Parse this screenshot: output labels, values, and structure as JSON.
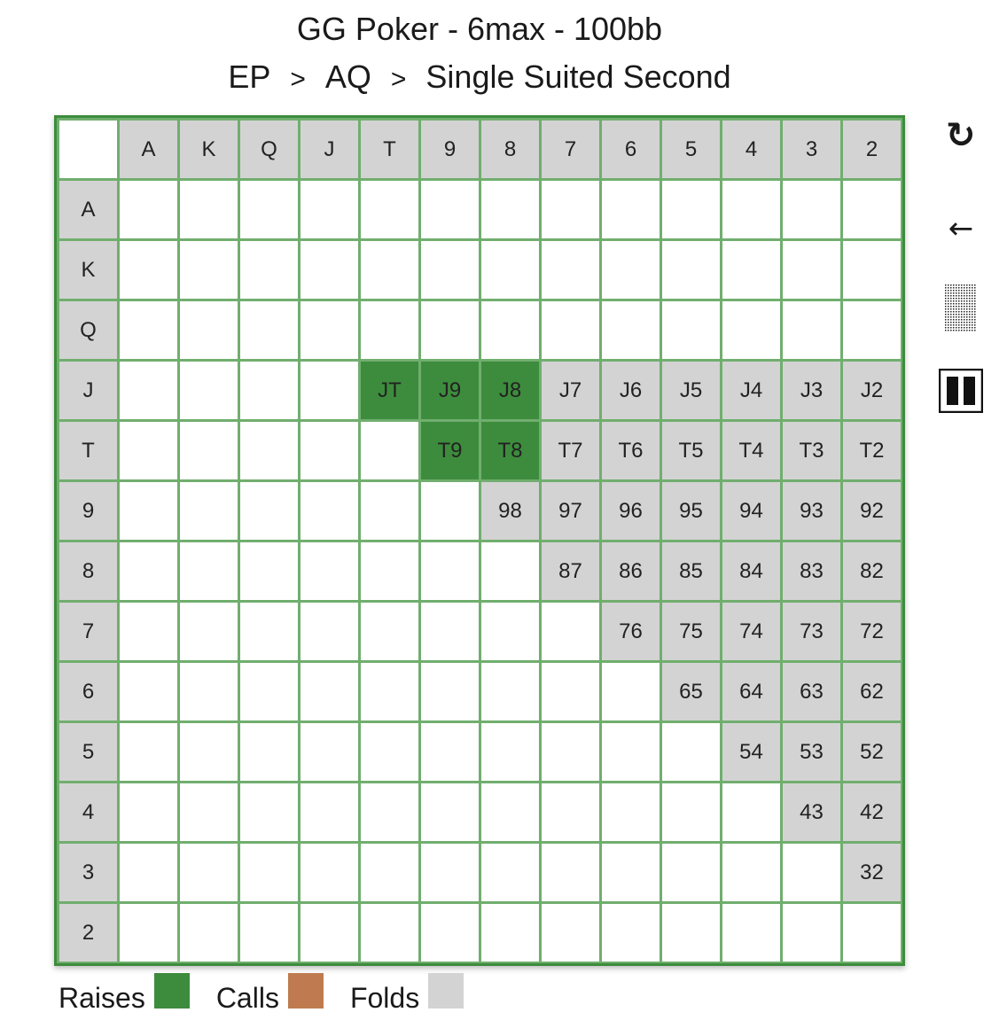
{
  "header": {
    "title": "GG Poker - 6max - 100bb",
    "breadcrumb": [
      "EP",
      "AQ",
      "Single Suited Second"
    ],
    "separator": ">"
  },
  "colors": {
    "raise": "#3d8c3d",
    "call": "#bf7b4f",
    "fold": "#d3d3d3",
    "grid_line": "#70ae6e"
  },
  "controls": {
    "reset_icon": "reset-icon",
    "back_icon": "back-arrow-icon",
    "pattern_icon": "dotted-pattern-icon",
    "pause_icon": "pause-icon",
    "back_glyph": "←",
    "reset_glyph": "↺"
  },
  "grid": {
    "ranks": [
      "A",
      "K",
      "Q",
      "J",
      "T",
      "9",
      "8",
      "7",
      "6",
      "5",
      "4",
      "3",
      "2"
    ],
    "raise_cells": [
      "JT",
      "J9",
      "J8",
      "T9",
      "T8"
    ],
    "call_cells": [],
    "fold_cells": [
      "J7",
      "J6",
      "J5",
      "J4",
      "J3",
      "J2",
      "T7",
      "T6",
      "T5",
      "T4",
      "T3",
      "T2",
      "98",
      "97",
      "96",
      "95",
      "94",
      "93",
      "92",
      "87",
      "86",
      "85",
      "84",
      "83",
      "82",
      "76",
      "75",
      "74",
      "73",
      "72",
      "65",
      "64",
      "63",
      "62",
      "54",
      "53",
      "52",
      "43",
      "42",
      "32"
    ]
  },
  "legend": {
    "raises": "Raises",
    "calls": "Calls",
    "folds": "Folds"
  }
}
